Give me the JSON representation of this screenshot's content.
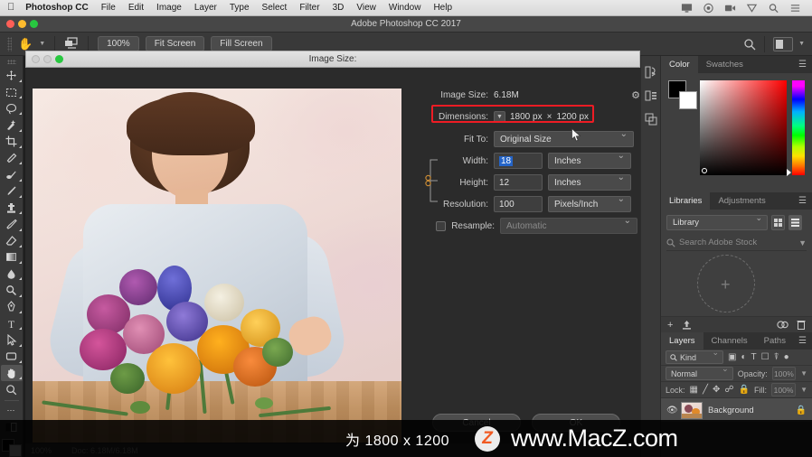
{
  "macbar": {
    "apple_icon": "apple-logo",
    "items": [
      "Photoshop CC",
      "File",
      "Edit",
      "Image",
      "Layer",
      "Type",
      "Select",
      "Filter",
      "3D",
      "View",
      "Window",
      "Help"
    ],
    "status_icons": [
      "display-icon",
      "cloud-sync-icon",
      "screen-record-icon",
      "shield-icon",
      "spotlight-search-icon",
      "notification-center-icon"
    ]
  },
  "window": {
    "title": "Adobe Photoshop CC 2017"
  },
  "options_bar": {
    "tool_icon": "hand-tool-icon",
    "zoom_value": "100%",
    "fit_screen": "Fit Screen",
    "fill_screen": "Fill Screen",
    "search_icon": "search-icon",
    "workspace_icon": "workspace-switcher-icon"
  },
  "toolbar": {
    "tools": [
      {
        "name": "move-tool",
        "glyph": "✛"
      },
      {
        "name": "marquee-tool",
        "glyph": "⬚"
      },
      {
        "name": "lasso-tool",
        "glyph": "◯"
      },
      {
        "name": "quick-selection-tool",
        "glyph": "✧"
      },
      {
        "name": "crop-tool",
        "glyph": "⌗"
      },
      {
        "name": "eyedropper-tool",
        "glyph": "✒"
      },
      {
        "name": "healing-brush-tool",
        "glyph": "✎"
      },
      {
        "name": "brush-tool",
        "glyph": "／"
      },
      {
        "name": "clone-stamp-tool",
        "glyph": "⌁"
      },
      {
        "name": "history-brush-tool",
        "glyph": "❧"
      },
      {
        "name": "eraser-tool",
        "glyph": "◣"
      },
      {
        "name": "gradient-tool",
        "glyph": "▤"
      },
      {
        "name": "blur-tool",
        "glyph": "💧"
      },
      {
        "name": "dodge-tool",
        "glyph": "🔍"
      },
      {
        "name": "pen-tool",
        "glyph": "✐"
      },
      {
        "name": "type-tool",
        "glyph": "T"
      },
      {
        "name": "path-selection-tool",
        "glyph": "➤"
      },
      {
        "name": "rectangle-tool",
        "glyph": "▭"
      },
      {
        "name": "hand-tool",
        "glyph": "✋"
      },
      {
        "name": "zoom-tool",
        "glyph": "⌕"
      },
      {
        "name": "more-tools",
        "glyph": "•••"
      }
    ],
    "selected_tool": "hand-tool",
    "foreground_color": "#000000",
    "background_color": "#ffffff"
  },
  "document": {
    "title": "Image Size",
    "status_zoom": "100%",
    "status_doc": "Doc: 6.18M/6.18M"
  },
  "dialog": {
    "image_size_label": "Image Size:",
    "image_size_value": "6.18M",
    "gear_icon": "gear-icon",
    "dimensions_label": "Dimensions:",
    "dimensions_width": "1800 px",
    "dimensions_separator": "×",
    "dimensions_height": "1200 px",
    "dimensions_highlight_color": "#ee1c24",
    "fit_to_label": "Fit To:",
    "fit_to_value": "Original Size",
    "width_label": "Width:",
    "width_value": "18",
    "width_unit": "Inches",
    "height_label": "Height:",
    "height_value": "12",
    "height_unit": "Inches",
    "resolution_label": "Resolution:",
    "resolution_value": "100",
    "resolution_unit": "Pixels/Inch",
    "resample_label": "Resample:",
    "resample_value": "Automatic",
    "cancel_label": "Cancel",
    "ok_label": "OK"
  },
  "dock_icons": [
    "history-panel-icon",
    "properties-panel-icon",
    "layer-comps-panel-icon"
  ],
  "color_panel": {
    "tabs": [
      {
        "label": "Color",
        "active": true
      },
      {
        "label": "Swatches",
        "active": false
      }
    ],
    "menu_icon": "panel-menu-icon",
    "foreground": "#000000",
    "background": "#ffffff"
  },
  "libraries_panel": {
    "tabs": [
      {
        "label": "Libraries",
        "active": true
      },
      {
        "label": "Adjustments",
        "active": false
      }
    ],
    "menu_icon": "panel-menu-icon",
    "library_select": "Library",
    "search_placeholder": "Search Adobe Stock",
    "search_icon": "search-icon",
    "grid_view_icon": "grid-view-icon",
    "list_view_icon": "list-view-icon",
    "add_icon": "add-element-icon",
    "upload_icon": "upload-icon",
    "sync_icon": "cloud-sync-icon",
    "delete_icon": "trash-icon"
  },
  "layers_panel": {
    "tabs": [
      {
        "label": "Layers",
        "active": true
      },
      {
        "label": "Channels",
        "active": false
      },
      {
        "label": "Paths",
        "active": false
      }
    ],
    "menu_icon": "panel-menu-icon",
    "kind_filter": "Kind",
    "filter_icons": [
      "pixel-filter-icon",
      "adjustment-filter-icon",
      "type-filter-icon",
      "shape-filter-icon",
      "smart-object-filter-icon",
      "filter-toggle-icon"
    ],
    "blend_mode": "Normal",
    "opacity_label": "Opacity:",
    "opacity_value": "100%",
    "lock_label": "Lock:",
    "lock_icons": [
      "lock-transparency-icon",
      "lock-image-icon",
      "lock-position-icon",
      "lock-artboard-icon",
      "lock-all-icon"
    ],
    "fill_label": "Fill:",
    "fill_value": "100%",
    "layers": [
      {
        "name": "Background",
        "visible_icon": "eye-icon",
        "locked_icon": "lock-icon"
      }
    ]
  },
  "watermark": {
    "caption": "为 1800 x 1200",
    "logo_letter": "Z",
    "url": "www.MacZ.com",
    "logo_color": "#f15a22"
  }
}
